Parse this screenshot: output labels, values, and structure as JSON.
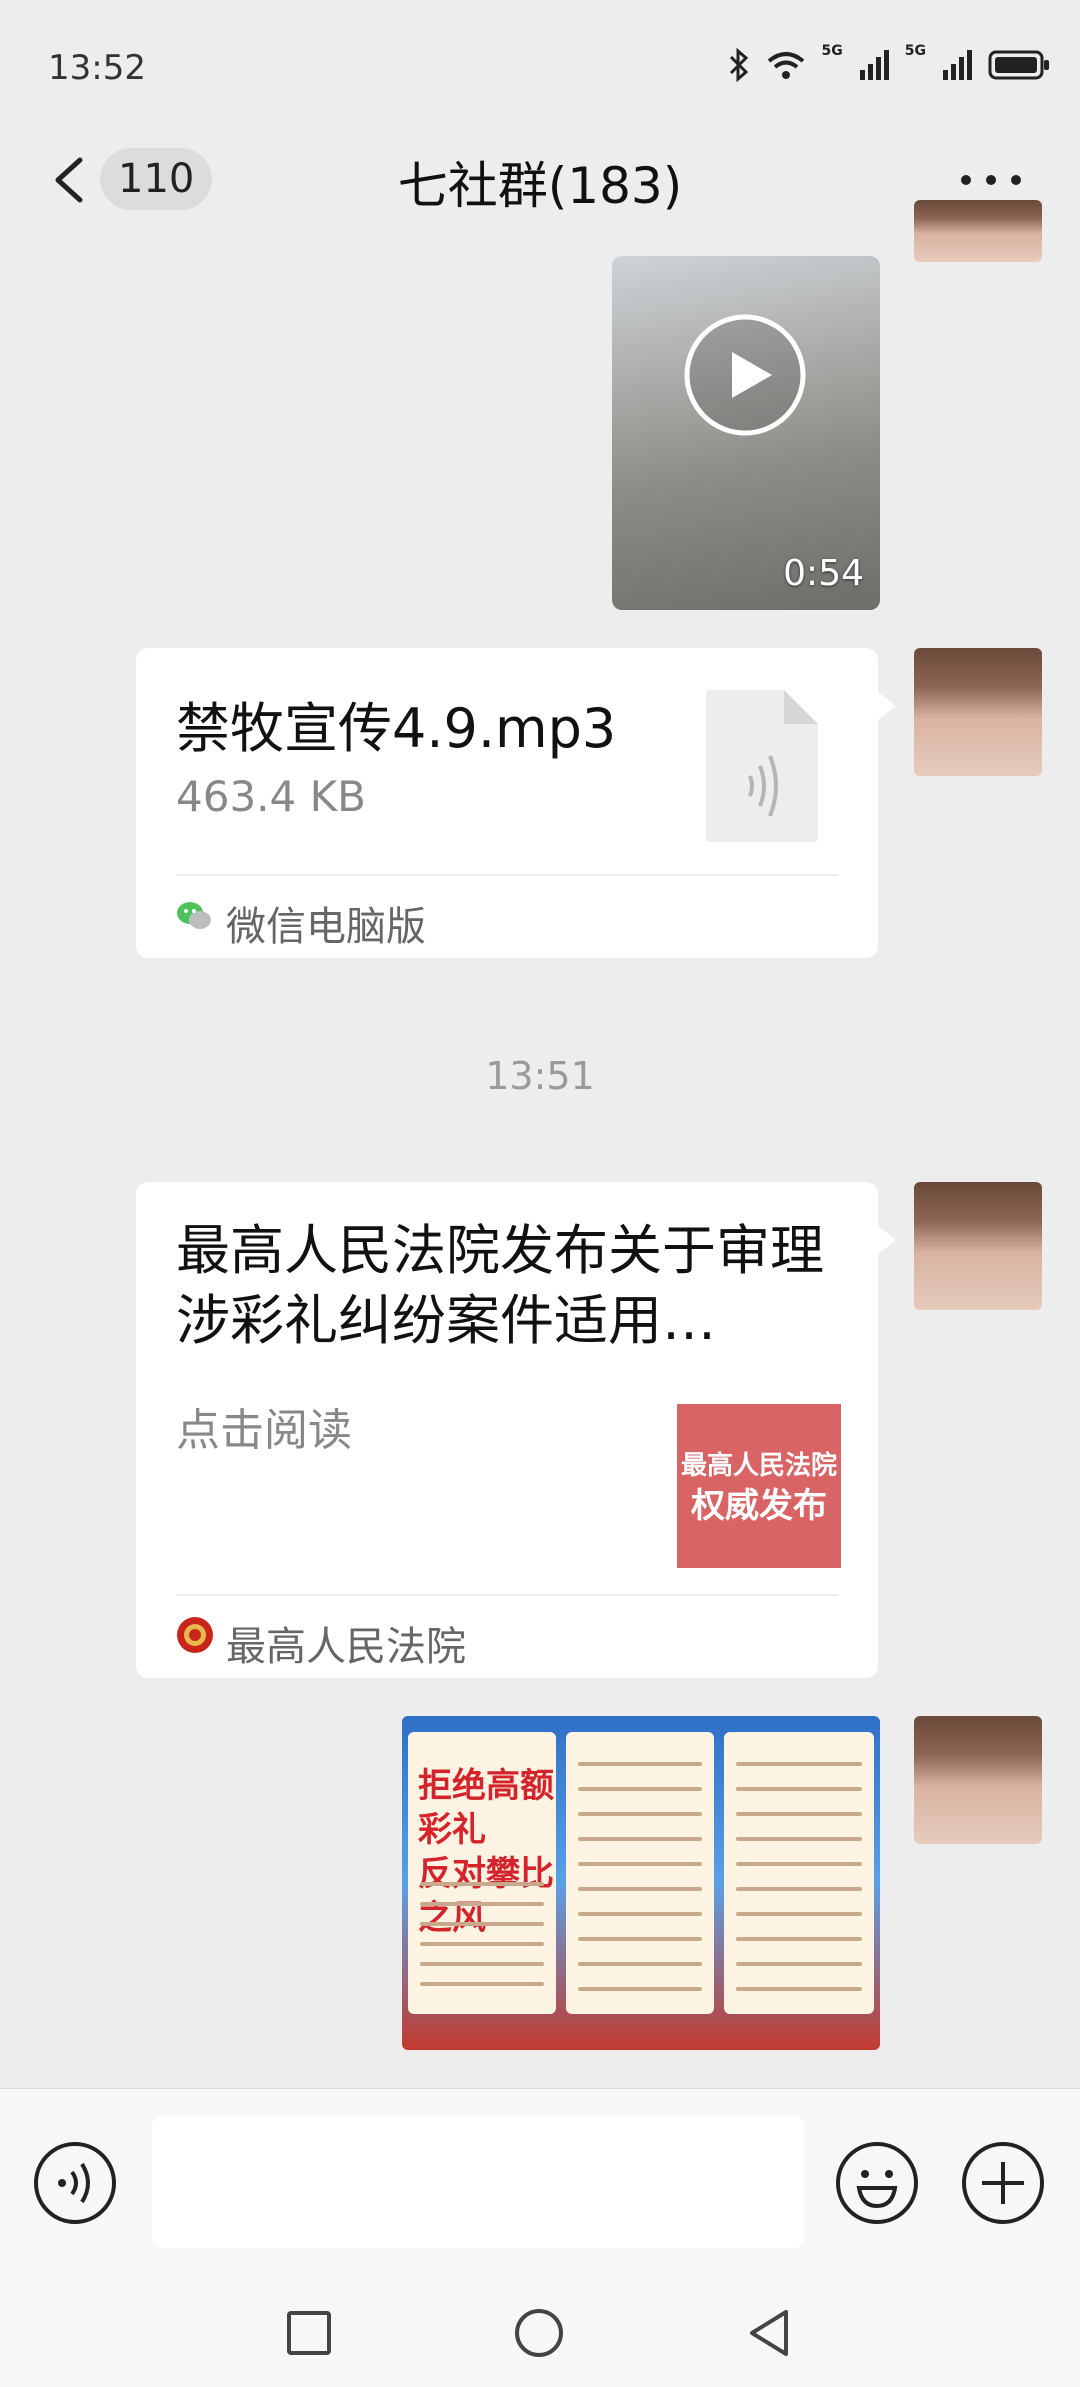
{
  "status_bar": {
    "time": "13:52",
    "network_1": "5G",
    "network_2": "5G",
    "icons": [
      "bluetooth-icon",
      "wifi-icon",
      "signal-icon",
      "signal-icon",
      "battery-icon"
    ]
  },
  "header": {
    "unread_count": "110",
    "title": "七社群(183)"
  },
  "messages": {
    "video": {
      "duration": "0:54"
    },
    "file": {
      "name": "禁牧宣传4.9.mp3",
      "size": "463.4 KB",
      "source": "微信电脑版"
    },
    "time_divider": "13:51",
    "article": {
      "title": "最高人民法院发布关于审理涉彩礼纠纷案件适用…",
      "action": "点击阅读",
      "thumb_line_1": "最高人民法院",
      "thumb_line_2": "权威发布",
      "source": "最高人民法院"
    },
    "poster": {
      "headline_1": "拒绝高额彩礼",
      "headline_2": "反对攀比之风"
    }
  },
  "input_bar": {
    "placeholder": ""
  },
  "colors": {
    "background": "#ededed",
    "bubble": "#ffffff",
    "accent_red": "#d86466"
  }
}
